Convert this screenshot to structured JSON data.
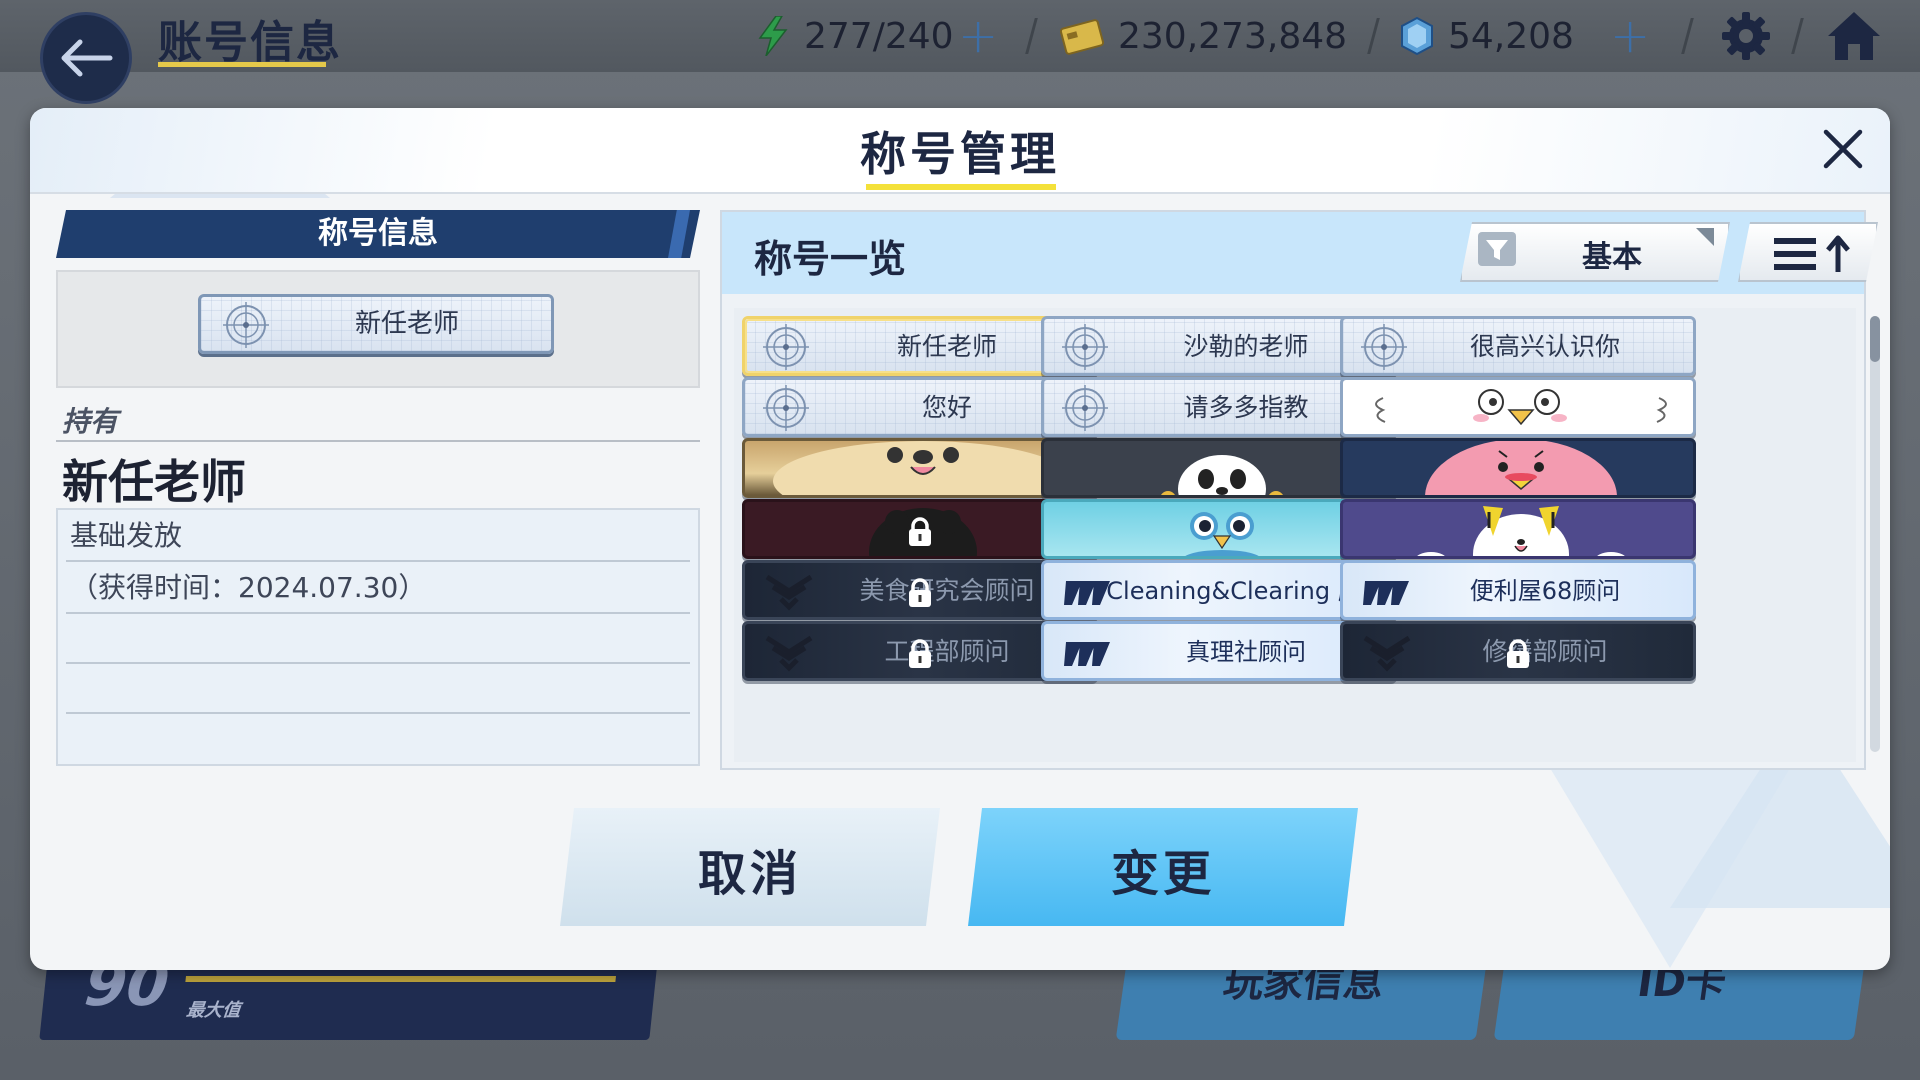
{
  "topbar": {
    "title": "账号信息",
    "ap": "277/240",
    "credits": "230,273,848",
    "gems": "54,208"
  },
  "background": {
    "level": "90",
    "level_label": "最大值",
    "tab1": "玩家信息",
    "tab2": "ID卡"
  },
  "modal": {
    "title": "称号管理",
    "left": {
      "header": "称号信息",
      "preview_title": "新任老师",
      "owned_label": "持有",
      "owned_name": "新任老师",
      "source": "基础发放",
      "obtained": "（获得时间：2024.07.30）"
    },
    "right": {
      "header": "称号一览",
      "filter_label": "基本",
      "titles": [
        {
          "label": "新任老师",
          "style": "plate",
          "selected": true,
          "locked": false
        },
        {
          "label": "沙勒的老师",
          "style": "plate",
          "selected": false,
          "locked": false
        },
        {
          "label": "很高兴认识你",
          "style": "plate",
          "selected": false,
          "locked": false
        },
        {
          "label": "您好",
          "style": "plate",
          "selected": false,
          "locked": false
        },
        {
          "label": "请多多指教",
          "style": "plate",
          "selected": false,
          "locked": false
        },
        {
          "label": "",
          "style": "face-white",
          "selected": false,
          "locked": false
        },
        {
          "label": "",
          "style": "face-tan",
          "selected": false,
          "locked": false
        },
        {
          "label": "",
          "style": "face-panda",
          "selected": false,
          "locked": false
        },
        {
          "label": "",
          "style": "face-pink",
          "selected": false,
          "locked": false
        },
        {
          "label": "",
          "style": "face-maroon",
          "selected": false,
          "locked": true
        },
        {
          "label": "",
          "style": "face-teal",
          "selected": false,
          "locked": false
        },
        {
          "label": "",
          "style": "face-purple",
          "selected": false,
          "locked": false
        },
        {
          "label": "美食研究会顾问",
          "style": "school-dark",
          "selected": false,
          "locked": true
        },
        {
          "label": "Cleaning&Clearing 顾问",
          "style": "school-light",
          "selected": false,
          "locked": false
        },
        {
          "label": "便利屋68顾问",
          "style": "school-light",
          "selected": false,
          "locked": false
        },
        {
          "label": "工程部顾问",
          "style": "school-dark",
          "selected": false,
          "locked": true
        },
        {
          "label": "真理社顾问",
          "style": "school-light",
          "selected": false,
          "locked": false
        },
        {
          "label": "修缮部顾问",
          "style": "school-dark",
          "selected": false,
          "locked": true
        }
      ]
    },
    "buttons": {
      "cancel": "取消",
      "change": "变更"
    }
  },
  "colors": {
    "navy": "#1d2742",
    "accent_yellow": "#f4e13a",
    "accent_blue": "#47b8f2"
  }
}
